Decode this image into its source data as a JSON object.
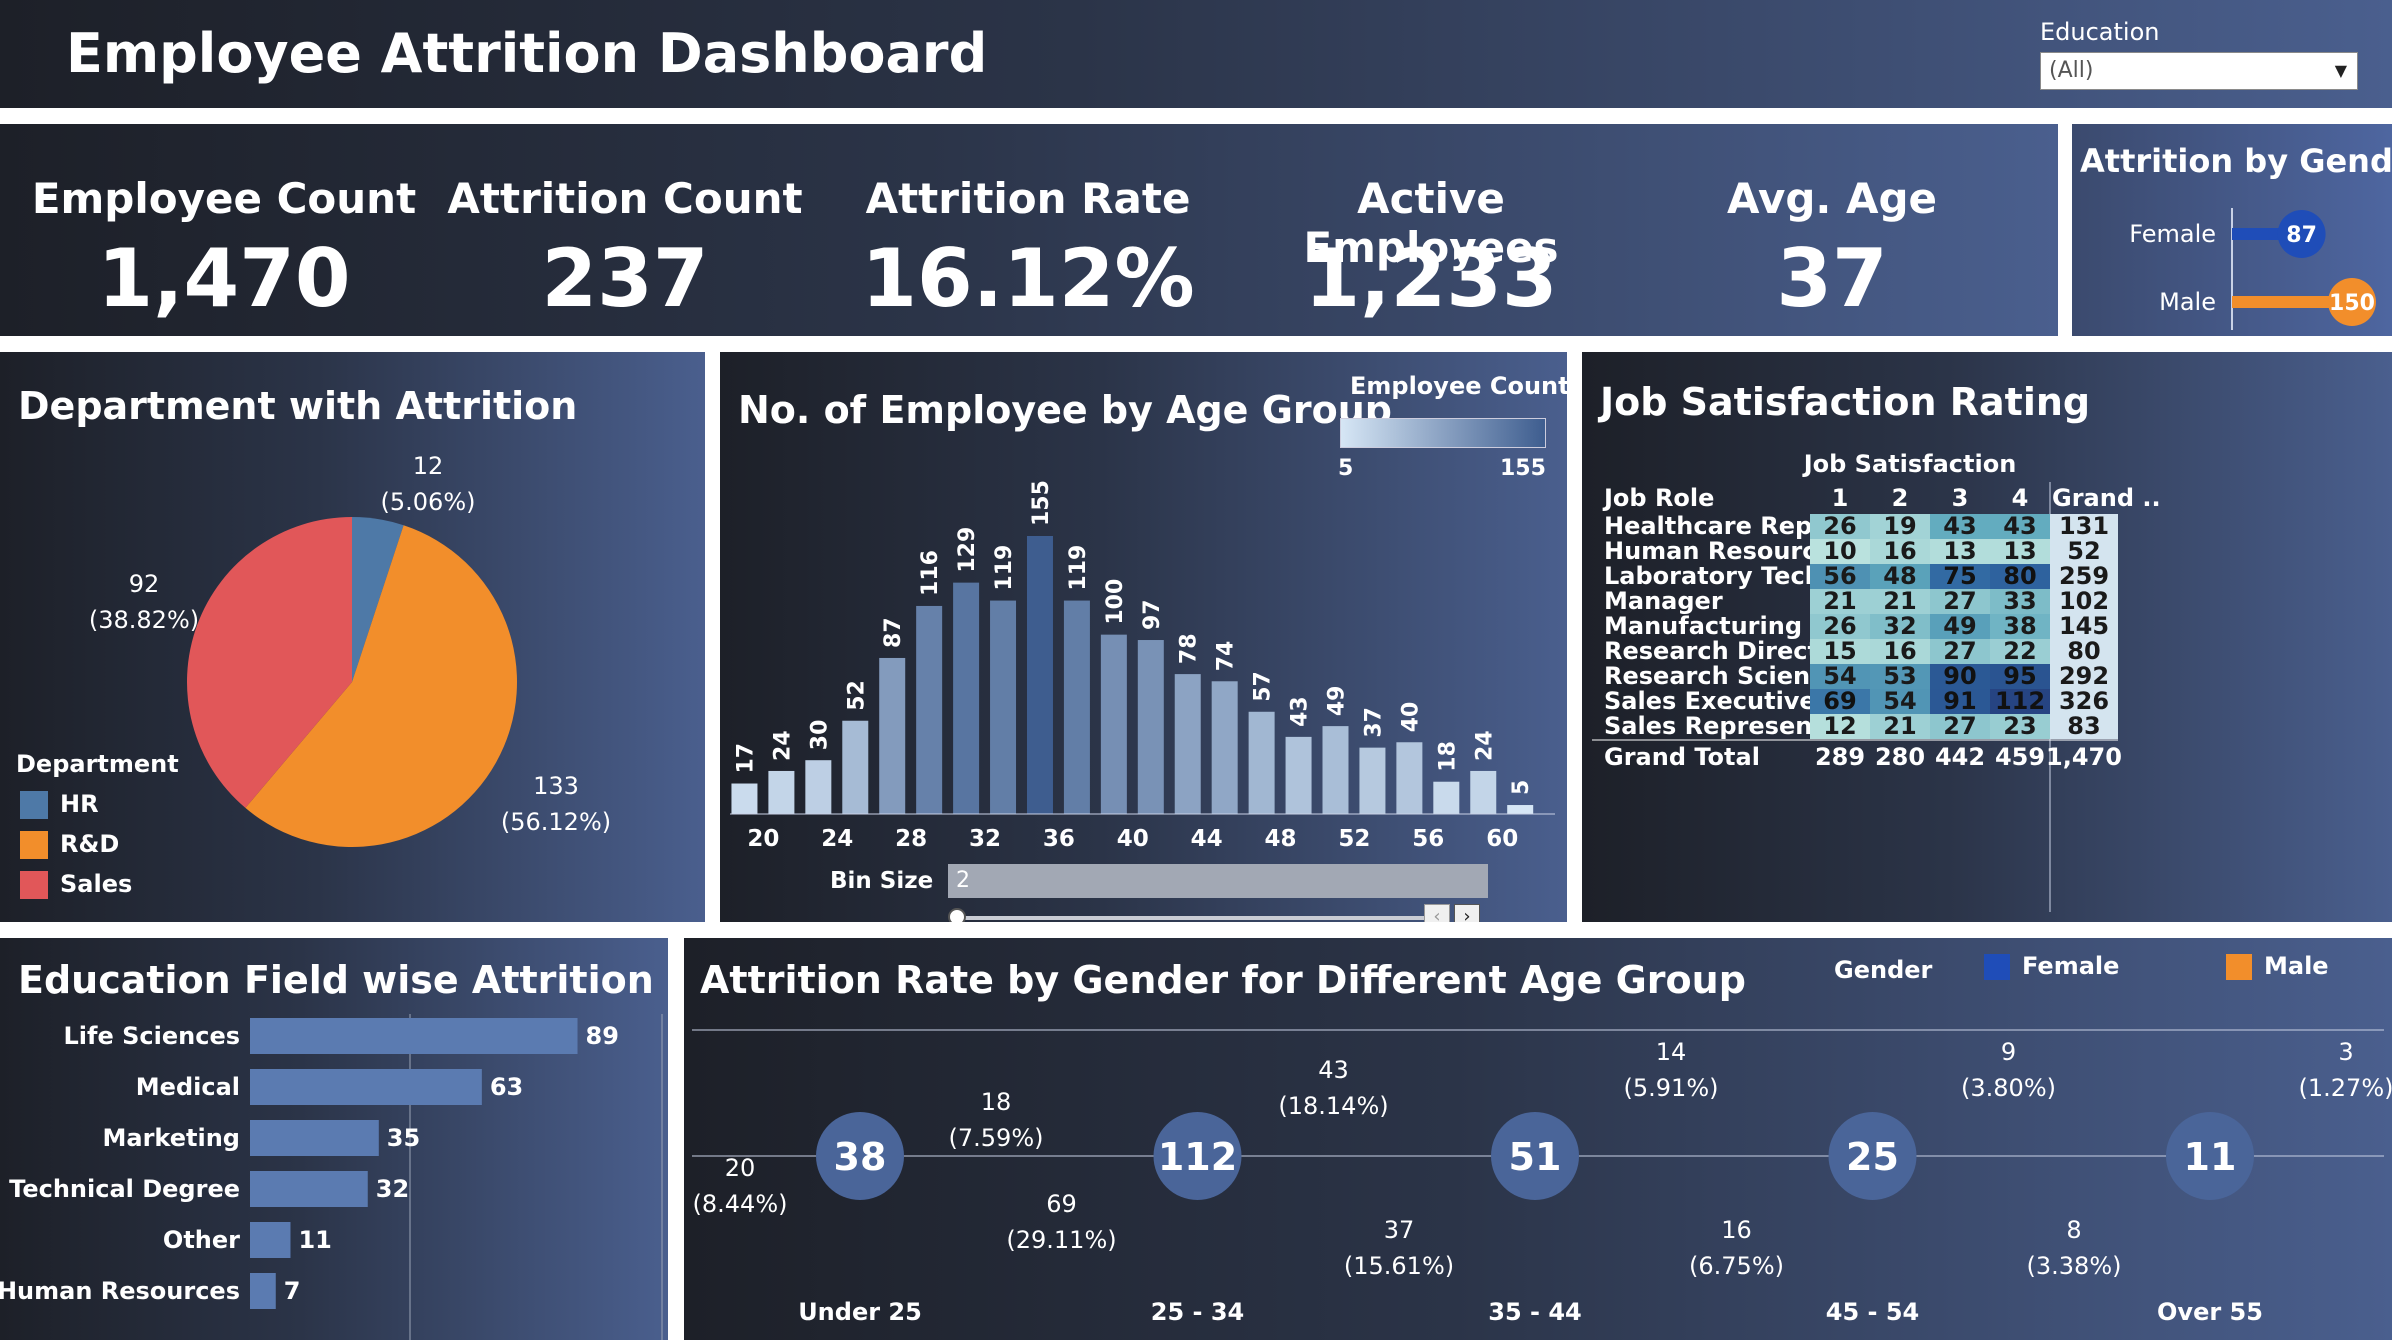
{
  "header": {
    "title": "Employee Attrition Dashboard",
    "filter_label": "Education",
    "filter_value": "(All)"
  },
  "kpis": [
    {
      "label": "Employee Count",
      "value": "1,470"
    },
    {
      "label": "Attrition Count",
      "value": "237"
    },
    {
      "label": "Attrition Rate",
      "value": "16.12%"
    },
    {
      "label": "Active Employees",
      "value": "1,233"
    },
    {
      "label": "Avg. Age",
      "value": "37"
    }
  ],
  "colors": {
    "hr": "#4e79a7",
    "rd": "#f28e2b",
    "sales": "#e15759",
    "female": "#1f4db8",
    "male": "#f28e2b",
    "bar": "#4e79a7"
  },
  "gender_attrition": {
    "title": "Attrition by Gender",
    "rows": [
      {
        "label": "Female",
        "value": 87,
        "display": "87",
        "color": "#1f4db8"
      },
      {
        "label": "Male",
        "value": 150,
        "display": "150",
        "color": "#f28e2b"
      }
    ]
  },
  "department": {
    "title": "Department with Attrition",
    "legend_title": "Department",
    "slices": [
      {
        "name": "HR",
        "value": 12,
        "label_value": "12",
        "label_pct": "(5.06%)",
        "color": "#4e79a7"
      },
      {
        "name": "R&D",
        "value": 133,
        "label_value": "133",
        "label_pct": "(56.12%)",
        "color": "#f28e2b"
      },
      {
        "name": "Sales",
        "value": 92,
        "label_value": "92",
        "label_pct": "(38.82%)",
        "color": "#e15759"
      }
    ]
  },
  "age_group": {
    "title": "No. of Employee by Age Group",
    "legend_title": "Employee Count",
    "legend_min": "5",
    "legend_max": "155",
    "bin_label": "Bin Size",
    "bin_value": "2",
    "x_ticks": [
      "20",
      "24",
      "28",
      "32",
      "36",
      "40",
      "44",
      "48",
      "52",
      "56",
      "60"
    ]
  },
  "chart_data": [
    {
      "type": "pie",
      "title": "Department with Attrition",
      "categories": [
        "HR",
        "R&D",
        "Sales"
      ],
      "values": [
        12,
        133,
        92
      ],
      "percent_labels": [
        "5.06%",
        "56.12%",
        "38.82%"
      ],
      "legend": "bottom-left"
    },
    {
      "type": "bar",
      "title": "No. of Employee by Age Group",
      "x": [
        18,
        20,
        22,
        24,
        26,
        28,
        30,
        32,
        34,
        36,
        38,
        40,
        42,
        44,
        46,
        48,
        50,
        52,
        54,
        56,
        58,
        60
      ],
      "values": [
        17,
        24,
        30,
        52,
        87,
        116,
        129,
        119,
        155,
        119,
        100,
        97,
        78,
        74,
        57,
        43,
        49,
        37,
        40,
        18,
        24,
        5
      ],
      "color_scale": [
        5,
        155
      ],
      "xlim": [
        18,
        61
      ]
    },
    {
      "type": "bar",
      "title": "Education Field wise Attrition",
      "orientation": "horizontal",
      "categories": [
        "Life Sciences",
        "Medical",
        "Marketing",
        "Technical Degree",
        "Other",
        "Human Resources"
      ],
      "values": [
        89,
        63,
        35,
        32,
        11,
        7
      ],
      "xlim": [
        0,
        100
      ]
    },
    {
      "type": "bar",
      "title": "Attrition by Gender",
      "orientation": "horizontal",
      "categories": [
        "Female",
        "Male"
      ],
      "values": [
        87,
        150
      ]
    },
    {
      "type": "pie",
      "title": "Attrition Rate by Gender for Different Age Group",
      "groups": [
        "Under 25",
        "25 - 34",
        "35 - 44",
        "45 - 54",
        "Over 55"
      ],
      "totals": [
        38,
        112,
        51,
        25,
        11
      ],
      "series": [
        {
          "name": "Female",
          "values": [
            18,
            43,
            14,
            9,
            3
          ]
        },
        {
          "name": "Male",
          "values": [
            20,
            69,
            37,
            16,
            8
          ]
        }
      ]
    },
    {
      "type": "table",
      "title": "Job Satisfaction Rating",
      "columns": [
        "1",
        "2",
        "3",
        "4"
      ],
      "rows": [
        "Healthcare Representative",
        "Human Resources",
        "Laboratory Technician",
        "Manager",
        "Manufacturing Director",
        "Research Director",
        "Research Scientist",
        "Sales Executive",
        "Sales Representative"
      ],
      "values": [
        [
          26,
          19,
          43,
          43
        ],
        [
          10,
          16,
          13,
          13
        ],
        [
          56,
          48,
          75,
          80
        ],
        [
          21,
          21,
          27,
          33
        ],
        [
          26,
          32,
          49,
          38
        ],
        [
          15,
          16,
          27,
          22
        ],
        [
          54,
          53,
          90,
          95
        ],
        [
          69,
          54,
          91,
          112
        ],
        [
          12,
          21,
          27,
          23
        ]
      ],
      "row_totals": [
        131,
        52,
        259,
        102,
        145,
        80,
        292,
        326,
        83
      ],
      "column_totals": [
        289,
        280,
        442,
        459
      ],
      "grand_total": 1470
    }
  ],
  "education": {
    "title": "Education Field wise Attrition",
    "rows": [
      {
        "label": "Life Sciences",
        "value": 89,
        "display": "89"
      },
      {
        "label": "Medical",
        "value": 63,
        "display": "63"
      },
      {
        "label": "Marketing",
        "value": 35,
        "display": "35"
      },
      {
        "label": "Technical Degree",
        "value": 32,
        "display": "32"
      },
      {
        "label": "Other",
        "value": 11,
        "display": "11"
      },
      {
        "label": "Human Resources",
        "value": 7,
        "display": "7"
      }
    ]
  },
  "gender_age": {
    "title": "Attrition Rate by Gender for Different Age Group",
    "legend_title": "Gender",
    "legend_female": "Female",
    "legend_male": "Male",
    "groups": [
      {
        "name": "Under 25",
        "total": "38",
        "female": 18,
        "male": 20,
        "female_label": "18",
        "female_pct": "(7.59%)",
        "male_label": "20",
        "male_pct": "(8.44%)"
      },
      {
        "name": "25 - 34",
        "total": "112",
        "female": 43,
        "male": 69,
        "female_label": "43",
        "female_pct": "(18.14%)",
        "male_label": "69",
        "male_pct": "(29.11%)"
      },
      {
        "name": "35 - 44",
        "total": "51",
        "female": 14,
        "male": 37,
        "female_label": "14",
        "female_pct": "(5.91%)",
        "male_label": "37",
        "male_pct": "(15.61%)"
      },
      {
        "name": "45 - 54",
        "total": "25",
        "female": 9,
        "male": 16,
        "female_label": "9",
        "female_pct": "(3.80%)",
        "male_label": "16",
        "male_pct": "(6.75%)"
      },
      {
        "name": "Over 55",
        "total": "11",
        "female": 3,
        "male": 8,
        "female_label": "3",
        "female_pct": "(1.27%)",
        "male_label": "8",
        "male_pct": "(3.38%)"
      }
    ]
  },
  "job_satisfaction": {
    "title": "Job Satisfaction Rating",
    "column_header": "Job Satisfaction",
    "row_header": "Job Role",
    "grand_col": "Grand ..",
    "grand_row": "Grand Total",
    "columns": [
      "1",
      "2",
      "3",
      "4"
    ],
    "rows": [
      {
        "role": "Healthcare Representative",
        "values": [
          "26",
          "19",
          "43",
          "43"
        ],
        "total": "131"
      },
      {
        "role": "Human Resources",
        "values": [
          "10",
          "16",
          "13",
          "13"
        ],
        "total": "52"
      },
      {
        "role": "Laboratory Technician",
        "values": [
          "56",
          "48",
          "75",
          "80"
        ],
        "total": "259"
      },
      {
        "role": "Manager",
        "values": [
          "21",
          "21",
          "27",
          "33"
        ],
        "total": "102"
      },
      {
        "role": "Manufacturing Director",
        "values": [
          "26",
          "32",
          "49",
          "38"
        ],
        "total": "145"
      },
      {
        "role": "Research Director",
        "values": [
          "15",
          "16",
          "27",
          "22"
        ],
        "total": "80"
      },
      {
        "role": "Research Scientist",
        "values": [
          "54",
          "53",
          "90",
          "95"
        ],
        "total": "292"
      },
      {
        "role": "Sales Executive",
        "values": [
          "69",
          "54",
          "91",
          "112"
        ],
        "total": "326"
      },
      {
        "role": "Sales Representative",
        "values": [
          "12",
          "21",
          "27",
          "23"
        ],
        "total": "83"
      }
    ],
    "col_totals": [
      "289",
      "280",
      "442",
      "459"
    ],
    "grand_total": "1,470"
  }
}
